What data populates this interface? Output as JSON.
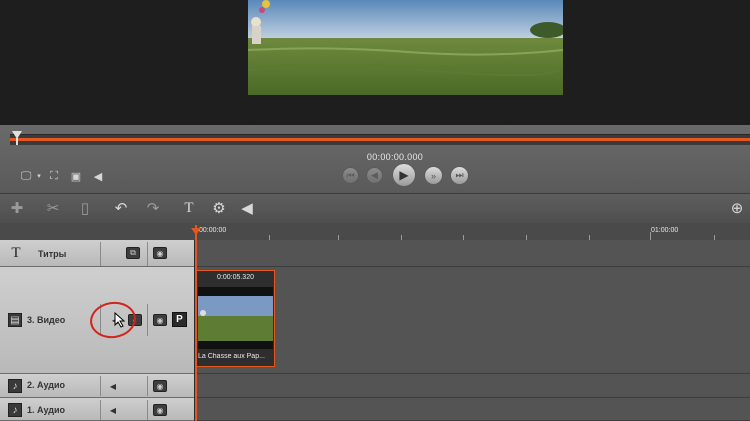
{
  "player": {
    "timecode": "00:00:00.000"
  },
  "ruler": {
    "start_label": "00:00:00",
    "end_label": "01:00:00"
  },
  "tracks": [
    {
      "label": "Титры",
      "icon": "title-T-icon"
    },
    {
      "label": "3. Видео",
      "icon": "film-icon"
    },
    {
      "label": "2. Аудио",
      "icon": "music-note-icon"
    },
    {
      "label": "1. Аудио",
      "icon": "music-note-icon"
    }
  ],
  "clip": {
    "duration": "0:00:05.320",
    "name": "La Chasse aux Pap..."
  },
  "video_track": {
    "p_button": "P"
  },
  "colors": {
    "accent": "#e4571f",
    "annotation": "#d0251c"
  }
}
